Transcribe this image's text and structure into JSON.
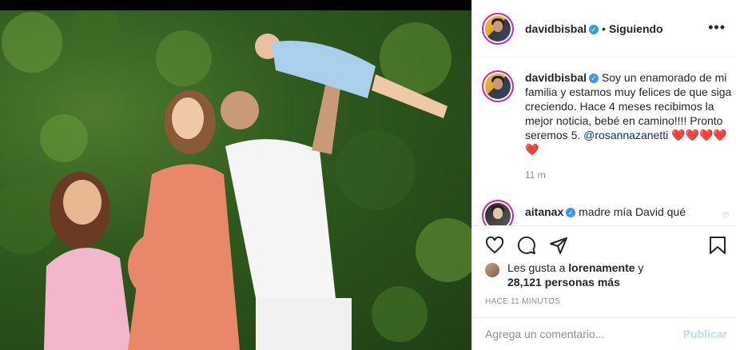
{
  "post": {
    "username": "davidbisbal",
    "verified_icon": "verified-badge-icon",
    "follow_status": "Siguiendo",
    "more_icon": "more-options-icon"
  },
  "caption": {
    "username": "davidbisbal",
    "text": "Soy un enamorado de mi familia y estamos muy felices de que siga creciendo. Hace 4 meses recibimos la mejor noticia, bebé en camino!!!! Pronto seremos 5.",
    "mention": "@rosannazanetti",
    "hearts": "❤️❤️❤️❤️❤️",
    "time": "11 m"
  },
  "comment": {
    "username": "aitanax",
    "text": "madre mía David qué"
  },
  "likes": {
    "prefix": "Les gusta a",
    "user": "lorenamente",
    "connector": "y",
    "count_text": "28,121 personas más"
  },
  "timestamp": "HACE 11 MINUTOS",
  "composer": {
    "placeholder": "Agrega un comentario...",
    "publish_label": "Publicar"
  },
  "colors": {
    "accent": "#3897f0",
    "publish_disabled": "#b2dffc",
    "heart": "#ed4956"
  }
}
